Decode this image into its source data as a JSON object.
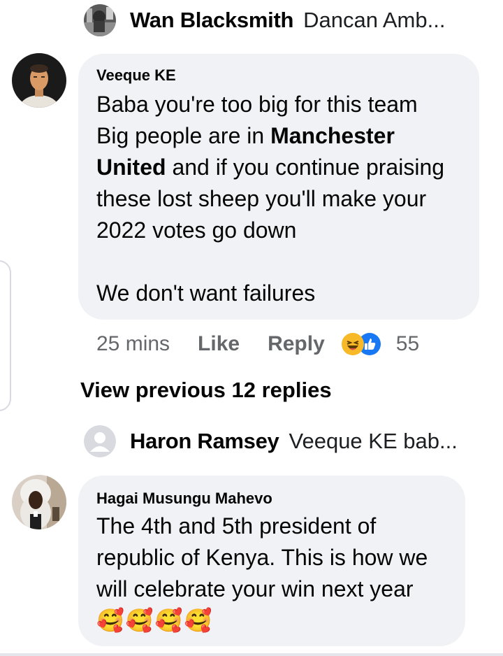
{
  "top_reply": {
    "name": "Wan Blacksmith",
    "snippet": "Dancan Amb..."
  },
  "comment1": {
    "author": "Veeque KE",
    "line1": "Baba you're too big for this team",
    "line2_pre": "Big people are in ",
    "line2_bold": "Manchester",
    "line3_bold": "United",
    "line3_post": " and if you continue praising",
    "line4": "these lost sheep you'll make your",
    "line5": "2022 votes go down",
    "line6": "We don't want failures",
    "time": "25 mins",
    "like_label": "Like",
    "reply_label": "Reply",
    "reaction_icons": [
      "laughing-emoji-icon",
      "like-thumb-icon"
    ],
    "reaction_count": "55"
  },
  "view_previous_label": "View previous 12 replies",
  "second_reply": {
    "name": "Haron Ramsey",
    "snippet": "Veeque KE bab..."
  },
  "comment2": {
    "author": "Hagai Musungu Mahevo",
    "line1": "The 4th and 5th president of",
    "line2": "republic of Kenya. This is how we",
    "line3": "will celebrate your win next year",
    "emoji": "🥰🥰🥰🥰"
  },
  "colors": {
    "bubble": "#f0f2f5",
    "meta": "#65676b",
    "text": "#050505",
    "like_blue": "#1877f2",
    "haha_yellow": "#f7b928"
  }
}
